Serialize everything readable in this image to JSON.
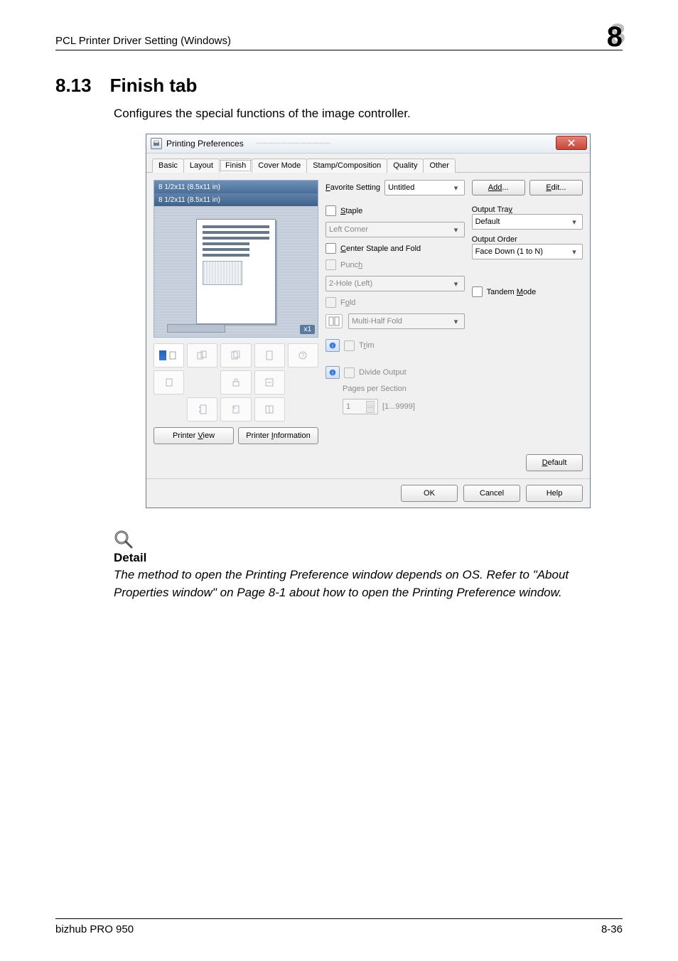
{
  "header": {
    "left": "PCL Printer Driver Setting (Windows)",
    "chapter": "8"
  },
  "section": {
    "num": "8.13",
    "title": "Finish tab"
  },
  "lead": "Configures the special functions of the image controller.",
  "dialog": {
    "title": "Printing Preferences",
    "tabs": {
      "basic": "Basic",
      "layout": "Layout",
      "finish": "Finish",
      "cover": "Cover Mode",
      "stamp": "Stamp/Composition",
      "quality": "Quality",
      "other": "Other"
    },
    "preview": {
      "line1": "8 1/2x11 (8.5x11 in)",
      "line2": "8 1/2x11 (8.5x11 in)",
      "badge": "x1"
    },
    "left_buttons": {
      "printer_view": "Printer View",
      "printer_info": "Printer Information"
    },
    "fav": {
      "label_pre": "F",
      "label_rest": "avorite Setting",
      "value": "Untitled",
      "add_pre": "Add",
      "add_rest": "...",
      "edit": "Edit..."
    },
    "staple": {
      "label_pre": "S",
      "label_rest": "taple",
      "value": "Left Corner"
    },
    "center_staple": {
      "pre": "C",
      "rest": "enter Staple and Fold"
    },
    "punch": {
      "label_pre": "Punc",
      "label_und": "h",
      "value": "2-Hole (Left)"
    },
    "fold": {
      "label_pre": "F",
      "label_und": "o",
      "label_rest": "ld",
      "value": "Multi-Half Fold"
    },
    "trim": {
      "pre": "T",
      "und": "r",
      "rest": "im"
    },
    "divide": {
      "label": "Divide Output",
      "sub": "Pages per Section",
      "value": "1",
      "range": "[1...9999]"
    },
    "output_tray": {
      "label": "Output Tra",
      "und": "y",
      "value": "Default"
    },
    "output_order": {
      "label": "Output Order",
      "value": "Face Down (1 to N)"
    },
    "tandem": {
      "pre": "Tandem ",
      "und": "M",
      "rest": "ode"
    },
    "default_btn": {
      "und": "D",
      "rest": "efault"
    },
    "footer": {
      "ok": "OK",
      "cancel": "Cancel",
      "help": "Help"
    }
  },
  "detail": {
    "title": "Detail",
    "text": "The method to open the Printing Preference window depends on OS. Refer to \"About Properties window\" on Page 8-1 about how to open the Printing Preference window."
  },
  "footer": {
    "left": "bizhub PRO 950",
    "right": "8-36"
  }
}
